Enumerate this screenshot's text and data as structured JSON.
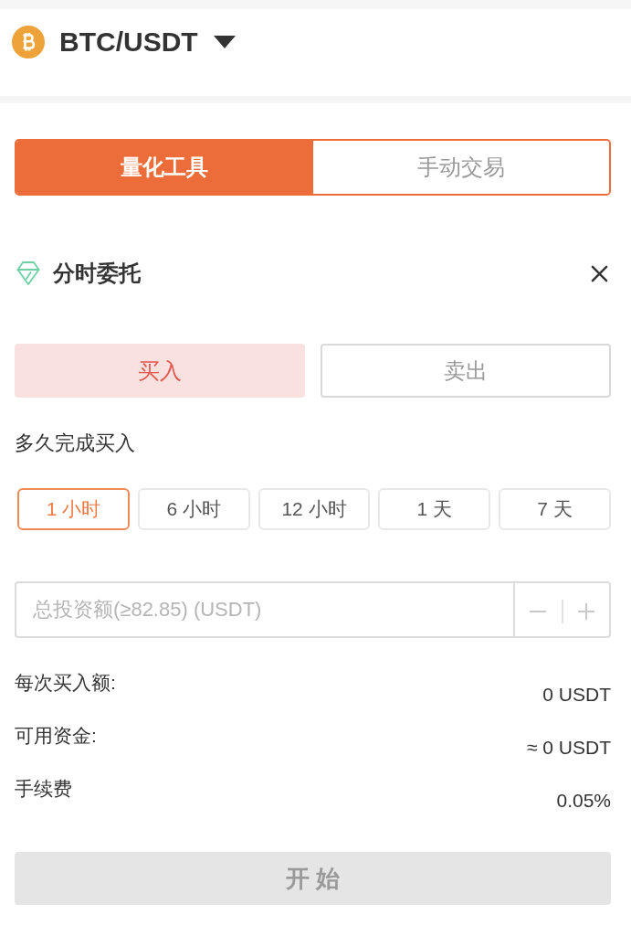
{
  "header": {
    "pair": "BTC/USDT"
  },
  "mode_tabs": [
    {
      "label": "量化工具",
      "selected": true
    },
    {
      "label": "手动交易",
      "selected": false
    }
  ],
  "section": {
    "title": "分时委托"
  },
  "sides": [
    {
      "label": "买入",
      "selected": true
    },
    {
      "label": "卖出",
      "selected": false
    }
  ],
  "duration": {
    "label": "多久完成买入",
    "options": [
      {
        "label": "1 小时",
        "selected": true
      },
      {
        "label": "6 小时",
        "selected": false
      },
      {
        "label": "12 小时",
        "selected": false
      },
      {
        "label": "1 天",
        "selected": false
      },
      {
        "label": "7 天",
        "selected": false
      }
    ]
  },
  "amount_field": {
    "placeholder": "总投资额(≥82.85) (USDT)"
  },
  "summary": [
    {
      "label": "每次买入额:",
      "value": "0 USDT"
    },
    {
      "label": "可用资金:",
      "value": "≈ 0 USDT"
    },
    {
      "label": "手续费",
      "value": "0.05%"
    }
  ],
  "start_button": {
    "label": "开 始",
    "disabled": true
  }
}
